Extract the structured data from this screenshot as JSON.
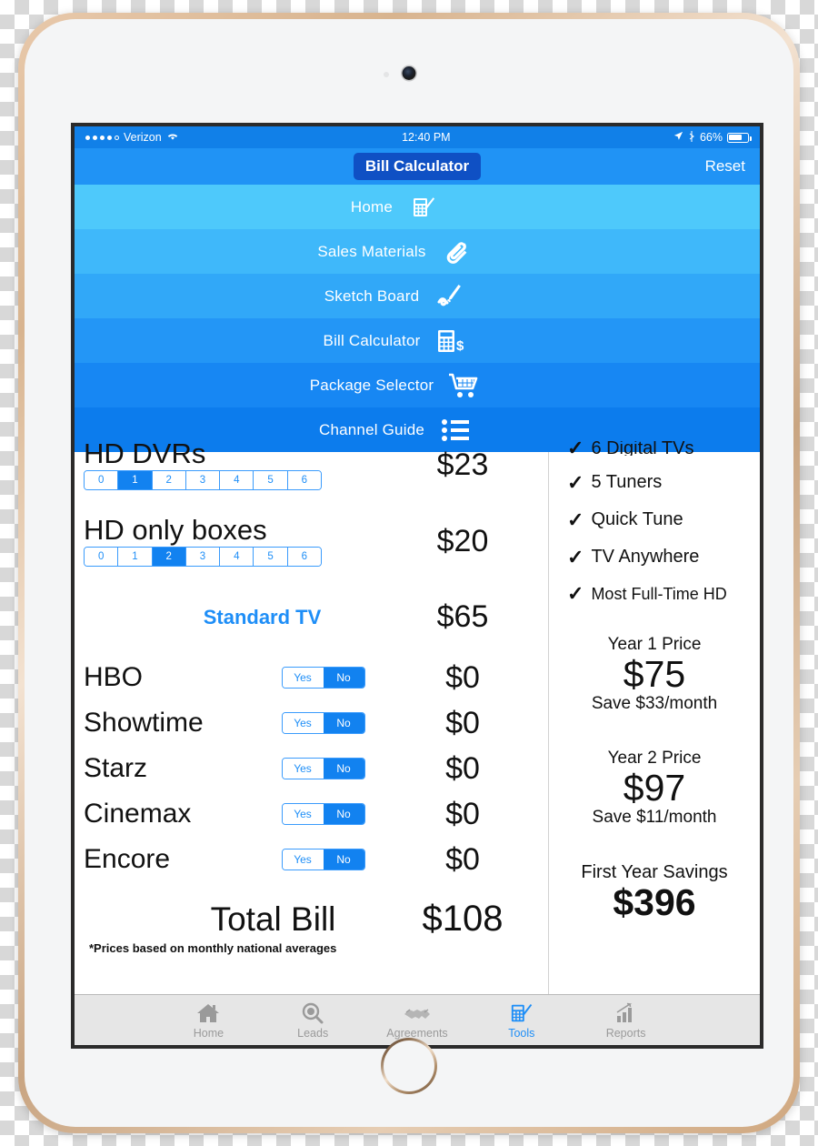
{
  "status_bar": {
    "carrier": "Verizon",
    "time": "12:40 PM",
    "battery": "66%"
  },
  "nav": {
    "title": "Bill Calculator",
    "reset_label": "Reset"
  },
  "menu": {
    "items": [
      {
        "label": "Home",
        "icon": "calculator-pencil-icon",
        "color": "#4ec9fb"
      },
      {
        "label": "Sales Materials",
        "icon": "paperclip-icon",
        "color": "#3fb8fa"
      },
      {
        "label": "Sketch Board",
        "icon": "sketch-pencil-icon",
        "color": "#31a8f8"
      },
      {
        "label": "Bill Calculator",
        "icon": "calculator-dollar-icon",
        "color": "#2396f6"
      },
      {
        "label": "Package Selector",
        "icon": "shopping-cart-icon",
        "color": "#1787f3"
      },
      {
        "label": "Channel Guide",
        "icon": "list-icon",
        "color": "#0c7ced"
      }
    ]
  },
  "calculator": {
    "counters": [
      {
        "title": "HD DVRs",
        "options": [
          "0",
          "1",
          "2",
          "3",
          "4",
          "5",
          "6"
        ],
        "selected": "1",
        "price": "$23"
      },
      {
        "title": "HD only boxes",
        "options": [
          "0",
          "1",
          "2",
          "3",
          "4",
          "5",
          "6"
        ],
        "selected": "2",
        "price": "$20"
      }
    ],
    "package": {
      "name": "Standard TV",
      "price": "$65"
    },
    "premiums": [
      {
        "name": "HBO",
        "yes_label": "Yes",
        "no_label": "No",
        "selected": "No",
        "price": "$0"
      },
      {
        "name": "Showtime",
        "yes_label": "Yes",
        "no_label": "No",
        "selected": "No",
        "price": "$0"
      },
      {
        "name": "Starz",
        "yes_label": "Yes",
        "no_label": "No",
        "selected": "No",
        "price": "$0"
      },
      {
        "name": "Cinemax",
        "yes_label": "Yes",
        "no_label": "No",
        "selected": "No",
        "price": "$0"
      },
      {
        "name": "Encore",
        "yes_label": "Yes",
        "no_label": "No",
        "selected": "No",
        "price": "$0"
      }
    ],
    "total": {
      "label": "Total Bill",
      "value": "$108"
    },
    "footnote": "*Prices based on monthly national averages"
  },
  "summary": {
    "features": [
      "6 Digital TVs",
      "5 Tuners",
      "Quick Tune",
      "TV Anywhere",
      "Most Full-Time HD"
    ],
    "year1": {
      "label": "Year 1 Price",
      "value": "$75",
      "save": "Save $33/month"
    },
    "year2": {
      "label": "Year 2 Price",
      "value": "$97",
      "save": "Save $11/month"
    },
    "first_year_savings": {
      "label": "First Year Savings",
      "value": "$396"
    }
  },
  "tabbar": {
    "tabs": [
      {
        "label": "Home",
        "icon": "house-icon",
        "active": false
      },
      {
        "label": "Leads",
        "icon": "magnifier-icon",
        "active": false
      },
      {
        "label": "Agreements",
        "icon": "handshake-icon",
        "active": false
      },
      {
        "label": "Tools",
        "icon": "calculator-pencil-icon",
        "active": true
      },
      {
        "label": "Reports",
        "icon": "bar-chart-icon",
        "active": false
      }
    ]
  },
  "colors": {
    "accent": "#1e8ef7",
    "navbar": "#2093f5",
    "title_pill": "#0f50c4",
    "statusbar": "#1180e8"
  }
}
